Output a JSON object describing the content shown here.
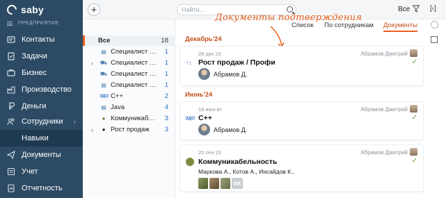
{
  "sidebar": {
    "brand": "saby",
    "org_label": "ПРЕДПРИЯТИЕ",
    "items": [
      {
        "label": "Контакты",
        "icon": "contacts-icon"
      },
      {
        "label": "Задачи",
        "icon": "tasks-icon"
      },
      {
        "label": "Бизнес",
        "icon": "business-icon"
      },
      {
        "label": "Производство",
        "icon": "production-icon"
      },
      {
        "label": "Деньги",
        "icon": "money-icon"
      },
      {
        "label": "Сотрудники",
        "icon": "employees-icon"
      },
      {
        "label": "Навыки",
        "icon": ""
      },
      {
        "label": "Документы",
        "icon": "documents-icon"
      },
      {
        "label": "Учет",
        "icon": "accounting-icon"
      },
      {
        "label": "Отчетность",
        "icon": "reports-icon"
      }
    ]
  },
  "topbar": {
    "search_placeholder": "Найти...",
    "filter_label": "Все"
  },
  "tabs": [
    "Список",
    "По сотрудникам",
    "Документы"
  ],
  "annotation": "Документы подтверждения",
  "skills": [
    {
      "label": "Все",
      "count": "18"
    },
    {
      "label": "Специалист по н...",
      "count": "1"
    },
    {
      "label": "Специалист по о...",
      "count": "1"
    },
    {
      "label": "Специалист по р...",
      "count": "1"
    },
    {
      "label": "Специалист про ...",
      "count": "1"
    },
    {
      "label": "C++",
      "count": "2"
    },
    {
      "label": "Java",
      "count": "4"
    },
    {
      "label": "Коммуникабельн...",
      "count": "3"
    },
    {
      "label": "Рост продаж",
      "count": "3"
    }
  ],
  "months": [
    "Декабрь'24",
    "Июнь'24"
  ],
  "cards": [
    {
      "date": "28 дек 23",
      "author": "Абрамов Дмитрий",
      "title": "Рост продаж / Профи",
      "person": "Абрамов Д."
    },
    {
      "date": "18 июн вт",
      "author": "Абрамов Дмитрий",
      "title": "C++",
      "person": "Абрамов Д."
    },
    {
      "date": "20 сен 23",
      "author": "Абрамов Дмитрий",
      "title": "Коммуникабельность",
      "people": "Маркова А., Котов А., Инсайдов К.,",
      "more_initials": "ИК"
    }
  ],
  "colors": {
    "sidebar_bg": "#2c4a63",
    "accent": "#e8601d",
    "link": "#2f6fbf",
    "check": "#5a9e2f"
  }
}
